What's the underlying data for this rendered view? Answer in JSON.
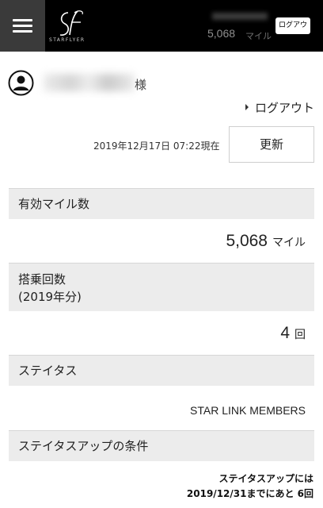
{
  "header": {
    "logo_text": "STARFLYER",
    "miles_value": "5,068",
    "miles_unit": "マイル",
    "logout_button": "ログアウト"
  },
  "user": {
    "honorific": "様"
  },
  "logout_link": "ログアウト",
  "timestamp": "2019年12月17日 07:22現在",
  "refresh_button": "更新",
  "sections": {
    "miles": {
      "label": "有効マイル数",
      "value": "5,068",
      "unit": "マイル"
    },
    "boarding": {
      "label_line1": "搭乗回数",
      "label_line2": "(2019年分)",
      "value": "4",
      "unit": "回"
    },
    "status": {
      "label": "ステイタス",
      "value": "STAR LINK MEMBERS"
    },
    "status_up": {
      "label": "ステイタスアップの条件",
      "line1": "ステイタスアップには",
      "line2": "2019/12/31までにあと 6回"
    }
  }
}
